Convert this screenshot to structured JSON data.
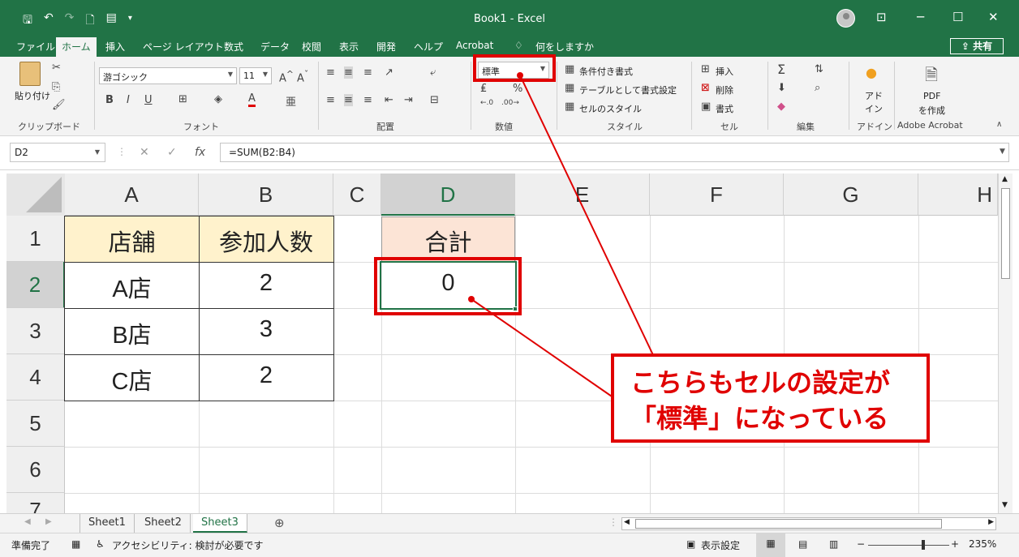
{
  "window": {
    "title": "Book1  -  Excel"
  },
  "menu": {
    "tabs": [
      "ファイル",
      "ホーム",
      "挿入",
      "ページ レイアウト",
      "数式",
      "データ",
      "校閲",
      "表示",
      "開発",
      "ヘルプ",
      "Acrobat"
    ],
    "active_tab": "ホーム",
    "tell_me": "何をしますか",
    "share_label": "共有"
  },
  "ribbon": {
    "clipboard": {
      "paste_label": "貼り付け",
      "group_label": "クリップボード"
    },
    "font": {
      "font_name": "游ゴシック",
      "font_size": "11",
      "bold": "B",
      "italic": "I",
      "underline": "U",
      "group_label": "フォント"
    },
    "alignment": {
      "group_label": "配置"
    },
    "number": {
      "format_value": "標準",
      "group_label": "数値"
    },
    "styles": {
      "conditional": "条件付き書式",
      "as_table": "テーブルとして書式設定",
      "cell_styles": "セルのスタイル",
      "group_label": "スタイル"
    },
    "cells": {
      "insert": "挿入",
      "delete": "削除",
      "format": "書式",
      "group_label": "セル"
    },
    "editing": {
      "group_label": "編集"
    },
    "addins": {
      "label_1": "アド",
      "label_2": "イン",
      "group_label": "アドイン"
    },
    "acrobat": {
      "pdf_label": "PDF",
      "create_label": "を作成",
      "group_label": "Adobe Acrobat"
    }
  },
  "formula_bar": {
    "name_box": "D2",
    "formula": "=SUM(B2:B4)"
  },
  "grid": {
    "columns": [
      "A",
      "B",
      "C",
      "D",
      "E",
      "F",
      "G",
      "H"
    ],
    "selected_column": "D",
    "rows": [
      "1",
      "2",
      "3",
      "4",
      "5",
      "6",
      "7"
    ],
    "selected_row": "2",
    "cells": {
      "A1": "店舗",
      "B1": "参加人数",
      "A2": "A店",
      "B2": "2",
      "A3": "B店",
      "B3": "3",
      "A4": "C店",
      "B4": "2",
      "D1": "合計",
      "D2": "0"
    },
    "colors": {
      "header_fill_A1B1": "#fff2cc",
      "header_fill_D1": "#fce4d6",
      "accent": "#217346",
      "annotation": "#e00000"
    }
  },
  "sheets": {
    "tabs": [
      "Sheet1",
      "Sheet2",
      "Sheet3"
    ],
    "active": "Sheet3"
  },
  "status": {
    "ready": "準備完了",
    "accessibility": "アクセシビリティ: 検討が必要です",
    "display_settings": "表示設定",
    "zoom": "235%"
  },
  "annotation": {
    "line1": "こちらもセルの設定が",
    "line2": "「標準」になっている"
  }
}
